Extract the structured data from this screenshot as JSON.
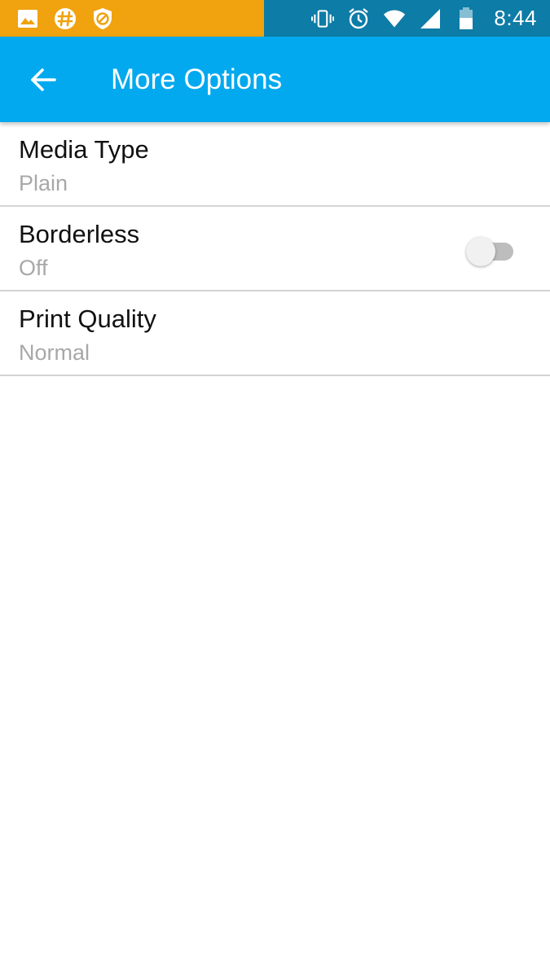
{
  "colors": {
    "status_left_bg": "#f0a20f",
    "status_right_bg": "#0d7ca6",
    "app_bar_bg": "#03a9ee",
    "toggle_track_off": "#bdbdbd",
    "toggle_thumb_off": "#f1f1f1"
  },
  "status_bar": {
    "left_icons": [
      "image-icon",
      "slack-icon",
      "blocked-shield-icon"
    ],
    "right_icons": [
      "vibrate-icon",
      "alarm-icon",
      "wifi-icon",
      "signal-icon",
      "battery-icon"
    ],
    "time": "8:44"
  },
  "app_bar": {
    "back_icon": "arrow-left-icon",
    "title": "More Options"
  },
  "options": [
    {
      "title": "Media Type",
      "value": "Plain",
      "has_toggle": false
    },
    {
      "title": "Borderless",
      "value": "Off",
      "has_toggle": true,
      "toggle_on": false
    },
    {
      "title": "Print Quality",
      "value": "Normal",
      "has_toggle": false
    }
  ]
}
